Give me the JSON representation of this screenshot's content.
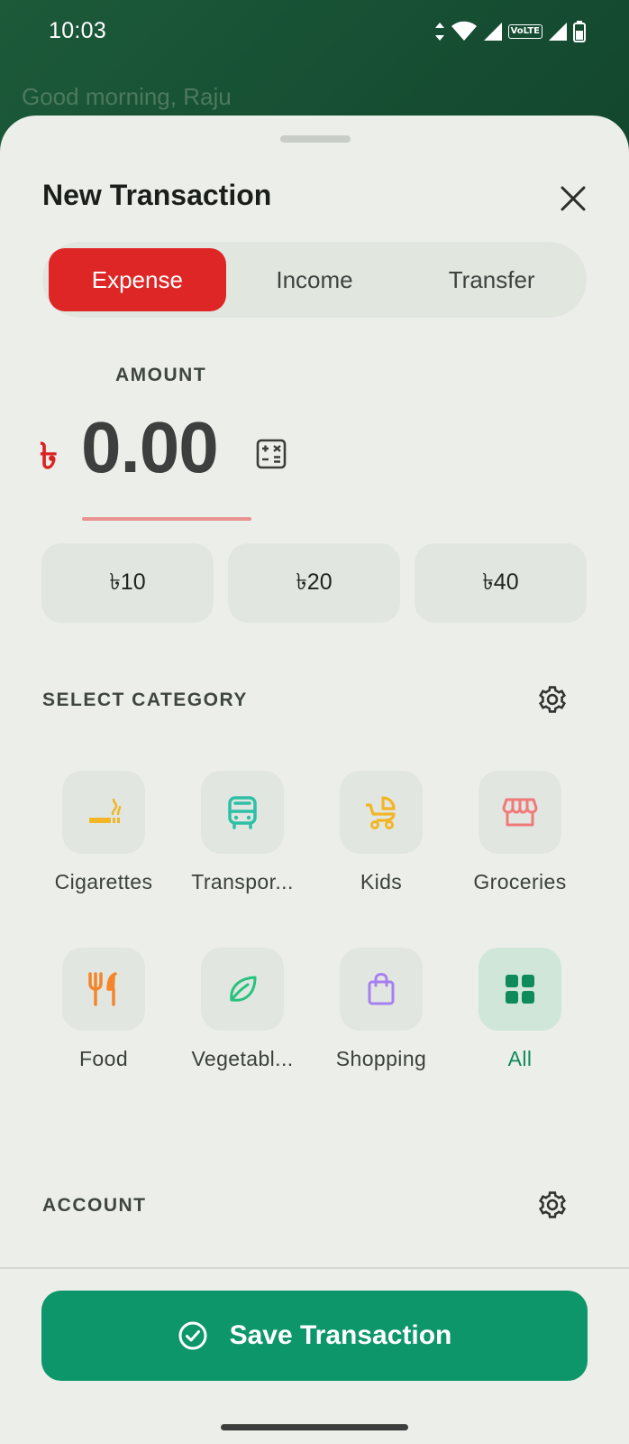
{
  "status_bar": {
    "time": "10:03",
    "volte": "VoLTE",
    "icons": [
      "data-arrows-icon",
      "wifi-icon",
      "signal-icon",
      "signal-icon",
      "battery-icon"
    ]
  },
  "background": {
    "greeting": "Good morning, Raju"
  },
  "sheet": {
    "title": "New Transaction",
    "tabs": [
      {
        "label": "Expense",
        "active": true
      },
      {
        "label": "Income",
        "active": false
      },
      {
        "label": "Transfer",
        "active": false
      }
    ],
    "amount": {
      "label": "AMOUNT",
      "currency_symbol": "৳",
      "value": "0.00"
    },
    "quick_amounts": [
      "৳10",
      "৳20",
      "৳40"
    ],
    "category_section": {
      "label": "SELECT CATEGORY",
      "items": [
        {
          "label": "Cigarettes",
          "icon": "cigarette-icon",
          "color": "#f2b526"
        },
        {
          "label": "Transpor...",
          "icon": "bus-icon",
          "color": "#2fbfa6"
        },
        {
          "label": "Kids",
          "icon": "stroller-icon",
          "color": "#f2b526"
        },
        {
          "label": "Groceries",
          "icon": "store-icon",
          "color": "#f07a7a"
        },
        {
          "label": "Food",
          "icon": "fork-knife-icon",
          "color": "#f5852b"
        },
        {
          "label": "Vegetabl...",
          "icon": "leaf-icon",
          "color": "#28c27e"
        },
        {
          "label": "Shopping",
          "icon": "shopping-bag-icon",
          "color": "#a77ff0"
        },
        {
          "label": "All",
          "icon": "grid-icon",
          "color": "#0f8a5a",
          "selected": true
        }
      ]
    },
    "account_section": {
      "label": "ACCOUNT"
    },
    "save_button": {
      "label": "Save Transaction"
    }
  },
  "colors": {
    "accent_red": "#de2626",
    "primary_green": "#0d966a",
    "sheet_bg": "#ecefe9"
  }
}
